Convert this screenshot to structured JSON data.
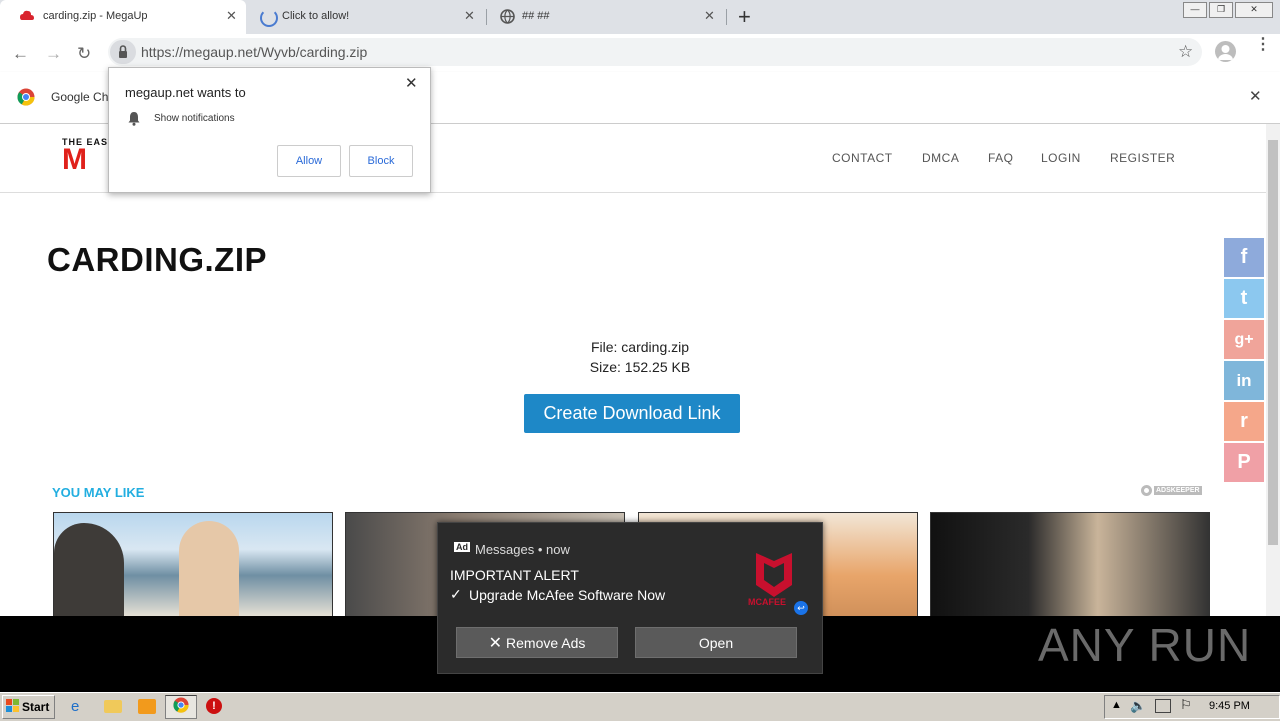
{
  "browser": {
    "tabs": [
      {
        "title": "carding.zip - MegaUp",
        "active": true
      },
      {
        "title": "Click to allow!",
        "active": false
      },
      {
        "title": "## ##",
        "active": false
      }
    ],
    "url": "https://megaup.net/Wyvb/carding.zip",
    "infobar_text": "Google Ch"
  },
  "permission_prompt": {
    "title": "megaup.net wants to",
    "item": "Show notifications",
    "allow_label": "Allow",
    "block_label": "Block"
  },
  "site": {
    "logo_text": "THE EAS",
    "logo_letter": "M",
    "nav": [
      "CONTACT",
      "DMCA",
      "FAQ",
      "LOGIN",
      "REGISTER"
    ]
  },
  "main": {
    "title": "CARDING.ZIP",
    "file_line": "File: carding.zip",
    "size_line": "Size: 152.25 KB",
    "download_button": "Create Download Link",
    "you_may_like": "YOU MAY LIKE",
    "adskeeper": "ADSKEEPER"
  },
  "social": [
    {
      "icon": "facebook-icon",
      "glyph": "f",
      "color": "#8eaadb"
    },
    {
      "icon": "twitter-icon",
      "glyph": "t",
      "color": "#8cc8ef"
    },
    {
      "icon": "google-plus-icon",
      "glyph": "g+",
      "color": "#f0a49a"
    },
    {
      "icon": "linkedin-icon",
      "glyph": "in",
      "color": "#7fb6da"
    },
    {
      "icon": "reddit-icon",
      "glyph": "r",
      "color": "#f5a78a"
    },
    {
      "icon": "pinterest-icon",
      "glyph": "P",
      "color": "#f0a0a6"
    }
  ],
  "ad_toast": {
    "header": "Messages • now",
    "alert": "IMPORTANT ALERT",
    "message": "Upgrade McAfee Software Now",
    "brand": "MCAFEE",
    "remove_label": "Remove Ads",
    "open_label": "Open"
  },
  "watermark": "ANY RUN",
  "taskbar": {
    "start_label": "Start",
    "clock": "9:45 PM"
  },
  "colors": {
    "accent": "#1e88c7",
    "you_may_like": "#22aee0",
    "logo_red": "#e0211b"
  }
}
